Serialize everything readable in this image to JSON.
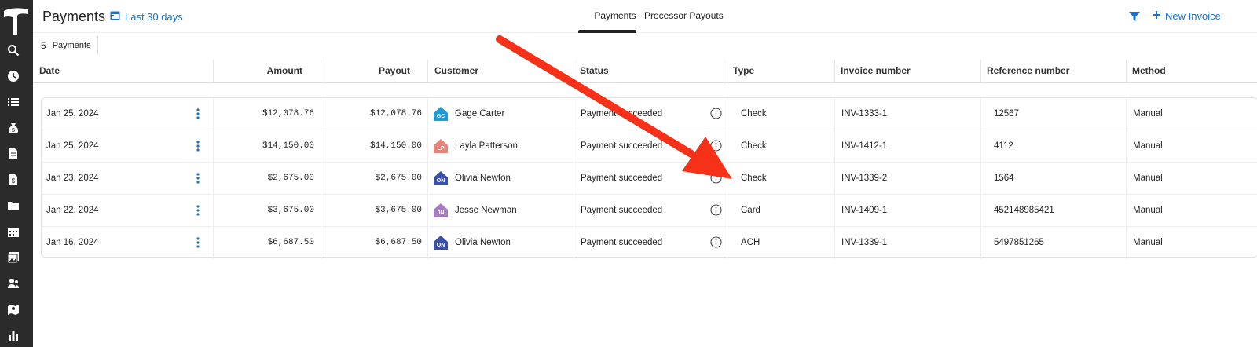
{
  "header": {
    "title": "Payments",
    "date_range": "Last 30 days",
    "tabs": [
      {
        "label": "Payments",
        "active": true
      },
      {
        "label": "Processor Payouts",
        "active": false
      }
    ],
    "new_invoice": "New Invoice"
  },
  "summary": {
    "count": "5",
    "label": "Payments"
  },
  "columns": [
    "Date",
    "Amount",
    "Payout",
    "Customer",
    "Status",
    "Type",
    "Invoice number",
    "Reference number",
    "Method"
  ],
  "rows": [
    {
      "date": "Jan 25, 2024",
      "amount": "$12,078.76",
      "payout": "$12,078.76",
      "initials": "GC",
      "avatar_color": "#1e9ad6",
      "customer": "Gage Carter",
      "status": "Payment succeeded",
      "type": "Check",
      "invoice": "INV-1333-1",
      "reference": "12567",
      "method": "Manual"
    },
    {
      "date": "Jan 25, 2024",
      "amount": "$14,150.00",
      "payout": "$14,150.00",
      "initials": "LP",
      "avatar_color": "#e8837a",
      "customer": "Layla Patterson",
      "status": "Payment succeeded",
      "type": "Check",
      "invoice": "INV-1412-1",
      "reference": "4112",
      "method": "Manual"
    },
    {
      "date": "Jan 23, 2024",
      "amount": "$2,675.00",
      "payout": "$2,675.00",
      "initials": "ON",
      "avatar_color": "#3a4fa8",
      "customer": "Olivia Newton",
      "status": "Payment succeeded",
      "type": "Check",
      "invoice": "INV-1339-2",
      "reference": "1564",
      "method": "Manual"
    },
    {
      "date": "Jan 22, 2024",
      "amount": "$3,675.00",
      "payout": "$3,675.00",
      "initials": "JN",
      "avatar_color": "#a77bc4",
      "customer": "Jesse Newman",
      "status": "Payment succeeded",
      "type": "Card",
      "invoice": "INV-1409-1",
      "reference": "452148985421",
      "method": "Manual"
    },
    {
      "date": "Jan 16, 2024",
      "amount": "$6,687.50",
      "payout": "$6,687.50",
      "initials": "ON",
      "avatar_color": "#3a4fa8",
      "customer": "Olivia Newton",
      "status": "Payment succeeded",
      "type": "ACH",
      "invoice": "INV-1339-1",
      "reference": "5497851265",
      "method": "Manual"
    }
  ],
  "sidebar": {
    "icons": [
      "search-icon",
      "clock-icon",
      "list-icon",
      "money-bag-icon",
      "document-icon",
      "invoice-icon",
      "folder-icon",
      "calendar-icon",
      "photos-icon",
      "people-icon",
      "map-icon",
      "chart-icon"
    ]
  },
  "colors": {
    "accent": "#1a73c8",
    "sidebar": "#2b2b2b",
    "annotation_arrow": "#f5311a"
  }
}
